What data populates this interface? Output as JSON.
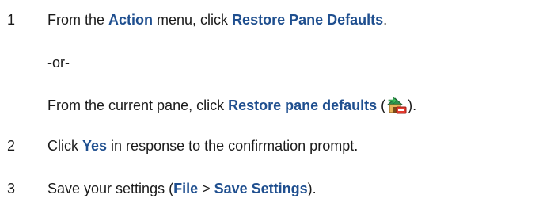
{
  "steps": [
    {
      "number": "1",
      "part1": "From the ",
      "action_menu": "Action",
      "part2": " menu, click ",
      "restore_defaults": "Restore Pane Defaults",
      "part3": "."
    },
    {
      "or": "-or-"
    },
    {
      "part1": "From the current pane, click ",
      "restore_pane_defaults": "Restore pane defaults",
      "paren_open": " (",
      "icon": "restore-pane-defaults-icon",
      "paren_close": ")."
    },
    {
      "number": "2",
      "part1": "Click ",
      "yes": "Yes",
      "part2": " in response to the confirmation prompt."
    },
    {
      "number": "3",
      "part1": "Save your settings (",
      "file": "File",
      "sep": " > ",
      "save_settings": "Save Settings",
      "part2": ")."
    }
  ],
  "colors": {
    "text": "#1a1a1a",
    "highlight": "#1f4f8f"
  }
}
